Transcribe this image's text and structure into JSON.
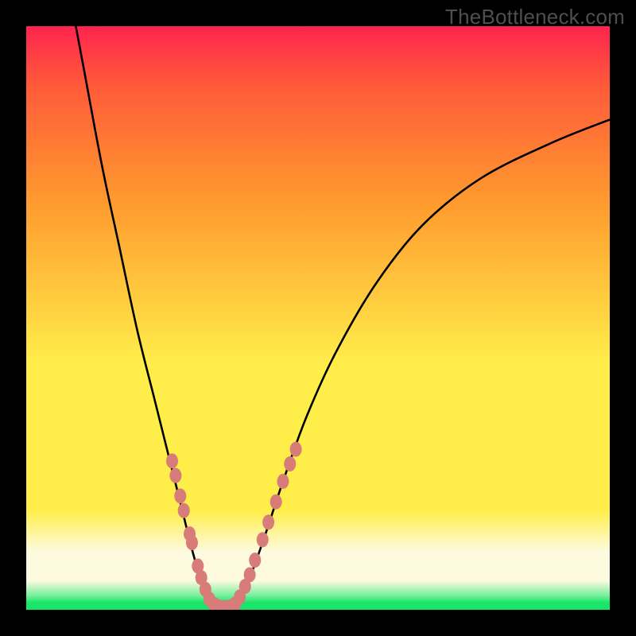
{
  "watermark": "TheBottleneck.com",
  "colors": {
    "bg": "#000000",
    "curve": "#000000",
    "marker_fill": "#d77c79",
    "marker_stroke": "#c96a67",
    "green": "#19e668",
    "green_light": "#7af09e",
    "yellow_pale": "#fdfadf",
    "yellow": "#ffee4a",
    "orange": "#ff9a2e",
    "red_orange": "#ff5a3a",
    "red": "#ff244e"
  },
  "chart_data": {
    "type": "line",
    "title": "",
    "xlabel": "",
    "ylabel": "",
    "xlim": [
      0,
      100
    ],
    "ylim": [
      0,
      100
    ],
    "curve": [
      {
        "x": 8.5,
        "y": 100
      },
      {
        "x": 10,
        "y": 92
      },
      {
        "x": 13,
        "y": 76
      },
      {
        "x": 16,
        "y": 62
      },
      {
        "x": 19,
        "y": 48
      },
      {
        "x": 22,
        "y": 36
      },
      {
        "x": 24.5,
        "y": 26
      },
      {
        "x": 26.5,
        "y": 18
      },
      {
        "x": 28.5,
        "y": 10
      },
      {
        "x": 30,
        "y": 5
      },
      {
        "x": 31.5,
        "y": 1.5
      },
      {
        "x": 33,
        "y": 0.5
      },
      {
        "x": 35,
        "y": 0.5
      },
      {
        "x": 36.5,
        "y": 2
      },
      {
        "x": 38.5,
        "y": 6
      },
      {
        "x": 41,
        "y": 13
      },
      {
        "x": 44,
        "y": 22
      },
      {
        "x": 48,
        "y": 33
      },
      {
        "x": 53,
        "y": 44
      },
      {
        "x": 60,
        "y": 56
      },
      {
        "x": 68,
        "y": 66
      },
      {
        "x": 78,
        "y": 74
      },
      {
        "x": 90,
        "y": 80
      },
      {
        "x": 100,
        "y": 84
      }
    ],
    "markers_left": [
      {
        "x": 25.0,
        "y": 25.5
      },
      {
        "x": 25.6,
        "y": 23.0
      },
      {
        "x": 26.4,
        "y": 19.5
      },
      {
        "x": 27.0,
        "y": 17.0
      },
      {
        "x": 28.0,
        "y": 13.0
      },
      {
        "x": 28.4,
        "y": 11.5
      },
      {
        "x": 29.4,
        "y": 7.5
      },
      {
        "x": 30.0,
        "y": 5.5
      },
      {
        "x": 30.7,
        "y": 3.5
      },
      {
        "x": 31.4,
        "y": 1.8
      }
    ],
    "markers_bottom": [
      {
        "x": 32.2,
        "y": 0.9
      },
      {
        "x": 33.0,
        "y": 0.5
      },
      {
        "x": 34.0,
        "y": 0.4
      },
      {
        "x": 35.0,
        "y": 0.5
      },
      {
        "x": 35.8,
        "y": 1.0
      }
    ],
    "markers_right": [
      {
        "x": 36.6,
        "y": 2.2
      },
      {
        "x": 37.5,
        "y": 4.0
      },
      {
        "x": 38.3,
        "y": 6.0
      },
      {
        "x": 39.2,
        "y": 8.5
      },
      {
        "x": 40.5,
        "y": 12.0
      },
      {
        "x": 41.5,
        "y": 15.0
      },
      {
        "x": 42.8,
        "y": 18.5
      },
      {
        "x": 44.0,
        "y": 22.0
      },
      {
        "x": 45.2,
        "y": 25.0
      },
      {
        "x": 46.2,
        "y": 27.5
      }
    ]
  }
}
